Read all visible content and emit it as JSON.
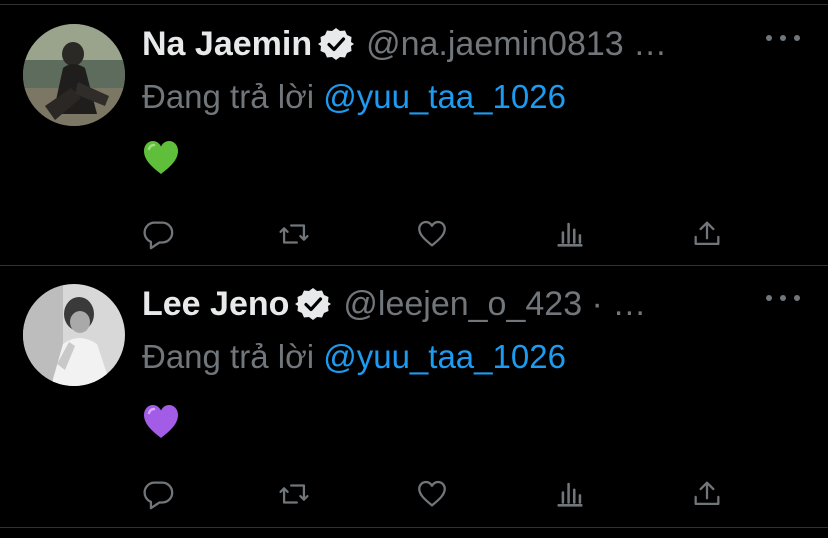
{
  "tweets": [
    {
      "author_name": "Na Jaemin",
      "handle": "@na.jaemin0813 …",
      "verified": true,
      "reply_prefix": "Đang trả lời",
      "reply_to": "@yuu_taa_1026",
      "content_emoji": "green-heart",
      "emoji_color": "#5fbf3b",
      "avatar_style": "color-photo"
    },
    {
      "author_name": "Lee Jeno",
      "handle": "@leejen_o_423 · …",
      "verified": true,
      "reply_prefix": "Đang trả lời",
      "reply_to": "@yuu_taa_1026",
      "content_emoji": "purple-heart",
      "emoji_color": "#a35ce6",
      "avatar_style": "grayscale-photo"
    }
  ],
  "actions": [
    "reply-icon",
    "retweet-icon",
    "like-icon",
    "views-icon",
    "share-icon"
  ],
  "colors": {
    "background": "#000000",
    "text": "#e7e9ea",
    "secondary": "#71767b",
    "accent": "#1d9bf0",
    "divider": "#2f3336"
  }
}
